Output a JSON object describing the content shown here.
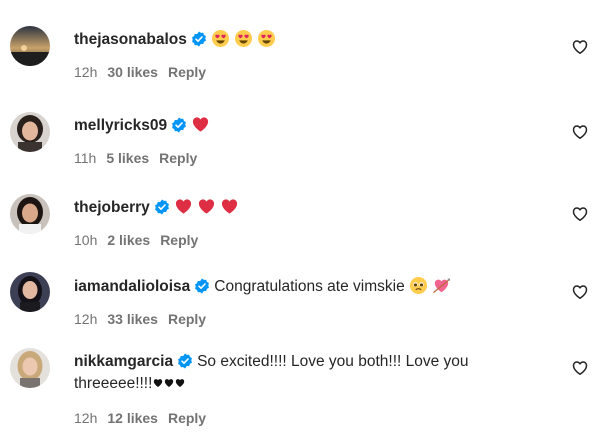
{
  "comments": [
    {
      "username": "thejasonabalos",
      "text": "",
      "emojis": [
        "heart-eyes",
        "heart-eyes",
        "heart-eyes"
      ],
      "time": "12h",
      "likes": "30 likes",
      "reply": "Reply"
    },
    {
      "username": "mellyricks09",
      "text": "",
      "emojis": [
        "red-heart"
      ],
      "time": "11h",
      "likes": "5 likes",
      "reply": "Reply"
    },
    {
      "username": "thejoberry",
      "text": "",
      "emojis": [
        "red-heart",
        "red-heart",
        "red-heart"
      ],
      "time": "10h",
      "likes": "2 likes",
      "reply": "Reply"
    },
    {
      "username": "iamandalioloisa",
      "text": "Congratulations ate vimskie",
      "emojis": [
        "pleading-face",
        "heart-with-arrow"
      ],
      "time": "12h",
      "likes": "33 likes",
      "reply": "Reply"
    },
    {
      "username": "nikkamgarcia",
      "text_line1": "So excited!!!! Love you both!!! Love you",
      "text_line2": "threeeee!!!!",
      "tail_hearts": [
        "black-heart",
        "black-heart",
        "black-heart"
      ],
      "time": "12h",
      "likes": "12 likes",
      "reply": "Reply"
    }
  ],
  "icons": {
    "verified": "verified-badge-icon",
    "like": "heart-outline-icon"
  },
  "colors": {
    "verified_blue": "#0095f6",
    "meta_gray": "#737373",
    "text": "#262626"
  }
}
